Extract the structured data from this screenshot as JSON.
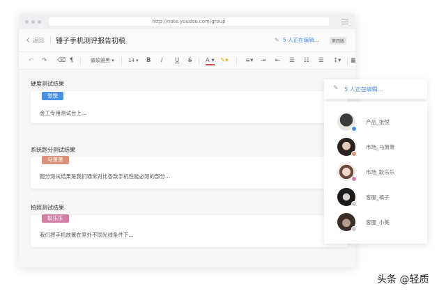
{
  "browser": {
    "url": "http://note.youdao.com/group"
  },
  "header": {
    "back_label": "返回",
    "doc_title": "锤子手机测评报告初稿",
    "editing_status": "5 人正在编辑...",
    "version_badge": "第四版"
  },
  "toolbar": {
    "font_name": "微软雅黑",
    "font_size": "14",
    "bold": "B",
    "italic": "I",
    "underline": "U",
    "strike": "S",
    "font_color": "A"
  },
  "sections": [
    {
      "label": "硬度测试结果",
      "tag": "张悦",
      "tag_color": "#4a90e2",
      "text": "金工专用测试台上..."
    },
    {
      "label": "系统跑分测试结果",
      "tag": "马萧萧",
      "tag_color": "#d9917a",
      "text": "跑分测试结果是我们通常对比各款手机性能必测的部分..."
    },
    {
      "label": "拍照测试结果",
      "tag": "耿乐乐",
      "tag_color": "#d07ea2",
      "text": "我们将手机放置在室外不同光线条件下..."
    }
  ],
  "collaborators": {
    "header": "5 人正在编辑...",
    "users": [
      {
        "name": "产品_张悦",
        "dot_color": "#4a90e2"
      },
      {
        "name": "市场_马萧萧",
        "dot_color": "#d9917a"
      },
      {
        "name": "市场_耿乐乐",
        "dot_color": "#d07ea2"
      },
      {
        "name": "客服_橘子",
        "dot_color": "#cccccc"
      },
      {
        "name": "客服_小美",
        "dot_color": "#cccccc"
      }
    ]
  },
  "watermark": "头条 @轻质"
}
